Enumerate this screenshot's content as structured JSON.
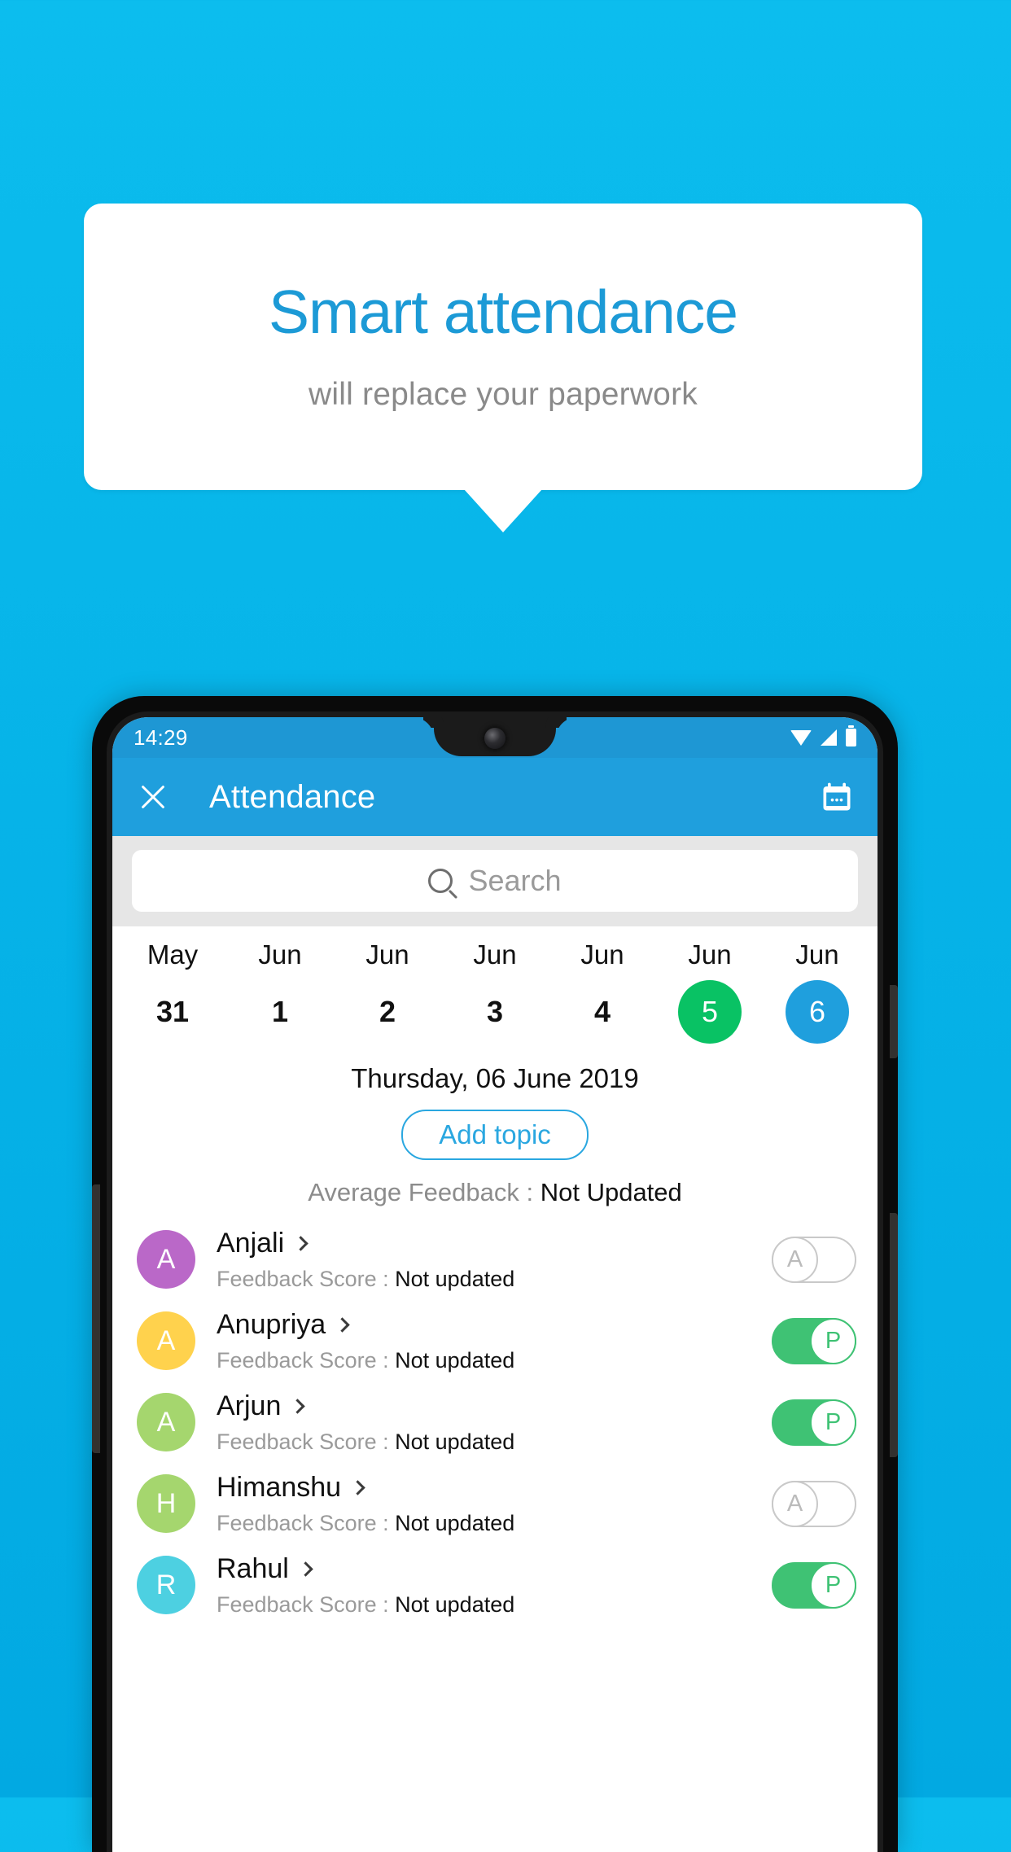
{
  "promo": {
    "title": "Smart attendance",
    "subtitle": "will replace your paperwork"
  },
  "colors": {
    "background_top": "#0CBDEE",
    "background_bottom": "#02A9E2",
    "brand_blue": "#1F9FDD",
    "title_blue": "#1C9AD6",
    "present_green": "#3FC274",
    "today_green": "#09C264",
    "selected_blue": "#1F9FDD"
  },
  "phone": {
    "status_bar": {
      "time": "14:29",
      "icons": [
        "wifi-icon",
        "signal-icon",
        "battery-icon"
      ]
    },
    "app_bar": {
      "close_icon": "close-icon",
      "title": "Attendance",
      "calendar_icon": "calendar-icon"
    },
    "search": {
      "icon": "search-icon",
      "placeholder": "Search",
      "value": ""
    },
    "date_strip": [
      {
        "month": "May",
        "day": "31",
        "state": "normal"
      },
      {
        "month": "Jun",
        "day": "1",
        "state": "normal"
      },
      {
        "month": "Jun",
        "day": "2",
        "state": "normal"
      },
      {
        "month": "Jun",
        "day": "3",
        "state": "normal"
      },
      {
        "month": "Jun",
        "day": "4",
        "state": "normal"
      },
      {
        "month": "Jun",
        "day": "5",
        "state": "today"
      },
      {
        "month": "Jun",
        "day": "6",
        "state": "selected"
      }
    ],
    "selected_date_label": "Thursday, 06 June 2019",
    "add_topic_label": "Add topic",
    "average_feedback": {
      "label": "Average Feedback : ",
      "value": "Not Updated"
    },
    "students": [
      {
        "name": "Anjali",
        "initial": "A",
        "avatar_color": "#BA68C8",
        "score_label": "Feedback Score : ",
        "score_value": "Not updated",
        "attendance": "A",
        "present": false
      },
      {
        "name": "Anupriya",
        "initial": "A",
        "avatar_color": "#FFD24D",
        "score_label": "Feedback Score : ",
        "score_value": "Not updated",
        "attendance": "P",
        "present": true
      },
      {
        "name": "Arjun",
        "initial": "A",
        "avatar_color": "#A5D66E",
        "score_label": "Feedback Score : ",
        "score_value": "Not updated",
        "attendance": "P",
        "present": true
      },
      {
        "name": "Himanshu",
        "initial": "H",
        "avatar_color": "#A5D66E",
        "score_label": "Feedback Score : ",
        "score_value": "Not updated",
        "attendance": "A",
        "present": false
      },
      {
        "name": "Rahul",
        "initial": "R",
        "avatar_color": "#4DD0E1",
        "score_label": "Feedback Score : ",
        "score_value": "Not updated",
        "attendance": "P",
        "present": true
      }
    ]
  }
}
